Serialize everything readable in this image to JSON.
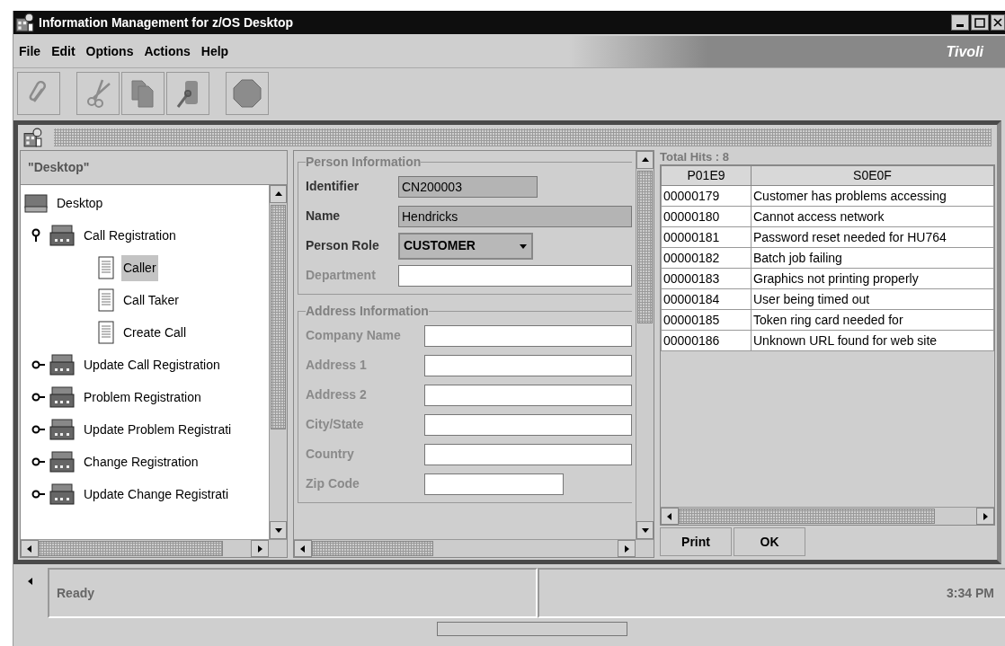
{
  "window": {
    "title": "Information Management for z/OS Desktop"
  },
  "menu": [
    "File",
    "Edit",
    "Options",
    "Actions",
    "Help"
  ],
  "brand": "Tivoli",
  "toolbar": [
    {
      "kind": "clip",
      "disabled": true
    },
    {
      "kind": "cut",
      "disabled": true
    },
    {
      "kind": "copy",
      "disabled": true
    },
    {
      "kind": "paste",
      "disabled": true
    },
    {
      "kind": "stop",
      "disabled": true
    }
  ],
  "navigator": {
    "header": "\"Desktop\"",
    "tree": [
      {
        "label": "Desktop",
        "kind": "root",
        "selected": false,
        "children": [
          {
            "label": "Call Registration",
            "kind": "folder",
            "expanded": true,
            "selected": false,
            "children": [
              {
                "label": "Caller",
                "kind": "form",
                "selected": true
              },
              {
                "label": "Call Taker",
                "kind": "form",
                "selected": false
              },
              {
                "label": "Create Call",
                "kind": "form",
                "selected": false
              }
            ]
          },
          {
            "label": "Update Call Registration",
            "kind": "folder",
            "expanded": false,
            "selected": false
          },
          {
            "label": "Problem Registration",
            "kind": "folder",
            "expanded": false,
            "selected": false
          },
          {
            "label": "Update Problem Registrati",
            "kind": "folder",
            "expanded": false,
            "selected": false
          },
          {
            "label": "Change Registration",
            "kind": "folder",
            "expanded": false,
            "selected": false
          },
          {
            "label": "Update Change Registrati",
            "kind": "folder",
            "expanded": false,
            "selected": false
          }
        ]
      }
    ]
  },
  "form": {
    "sections": [
      {
        "title": "Person Information",
        "fields": [
          {
            "label": "Identifier",
            "kind": "short",
            "value": "CN200003",
            "readonly": true,
            "disabled": false
          },
          {
            "label": "Name",
            "kind": "text",
            "value": "Hendricks",
            "readonly": true,
            "disabled": false
          },
          {
            "label": "Person Role",
            "kind": "select",
            "value": "CUSTOMER"
          },
          {
            "label": "Department",
            "kind": "text",
            "readonly": false,
            "disabled": true
          }
        ]
      },
      {
        "title": "Address Information",
        "fields": [
          {
            "label": "Company Name",
            "kind": "text",
            "readonly": false,
            "disabled": true
          },
          {
            "label": "Address 1",
            "kind": "text",
            "readonly": false,
            "disabled": true
          },
          {
            "label": "Address 2",
            "kind": "text",
            "readonly": false,
            "disabled": true
          },
          {
            "label": "City/State",
            "kind": "text",
            "readonly": false,
            "disabled": true
          },
          {
            "label": "Country",
            "kind": "text",
            "readonly": false,
            "disabled": true
          },
          {
            "label": "Zip Code",
            "kind": "short",
            "readonly": false,
            "disabled": true
          }
        ]
      }
    ]
  },
  "results": {
    "total": "Total Hits : 8",
    "columns": [
      "P01E9",
      "S0E0F"
    ],
    "rows": [
      [
        "00000179",
        "Customer has problems accessing"
      ],
      [
        "00000180",
        "Cannot access network"
      ],
      [
        "00000181",
        "Password reset needed for HU764"
      ],
      [
        "00000182",
        "Batch job failing"
      ],
      [
        "00000183",
        "Graphics not printing properly"
      ],
      [
        "00000184",
        "User being timed out"
      ],
      [
        "00000185",
        "Token ring card needed for"
      ],
      [
        "00000186",
        "Unknown URL found for web site"
      ]
    ],
    "buttons": [
      "Print",
      "OK"
    ]
  },
  "status_bar": {
    "message": "Ready",
    "time": "3:34 PM"
  }
}
